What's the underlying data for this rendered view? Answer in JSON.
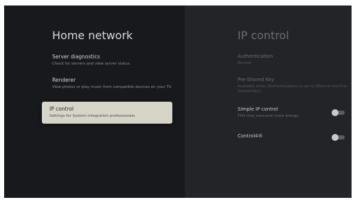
{
  "left_panel": {
    "title": "Home network",
    "items": [
      {
        "label": "Server diagnostics",
        "description": "Check for servers and view server status."
      },
      {
        "label": "Renderer",
        "description": "View photos or play music from compatible devices on your TV."
      },
      {
        "label": "IP control",
        "description": "Settings for System integration professionals.",
        "focused": true
      }
    ]
  },
  "right_panel": {
    "title": "IP control",
    "settings": [
      {
        "label": "Authentication",
        "value": "Normal",
        "enabled": false
      },
      {
        "label": "Pre-Shared Key",
        "value": "Available when [Authentication] is set to [Normal and Pre-Shared Key].",
        "enabled": false
      },
      {
        "label": "Simple IP control",
        "value": "This may consume more energy.",
        "enabled": true,
        "toggle_on": false
      },
      {
        "label": "Control4®",
        "enabled": true,
        "toggle_on": false
      }
    ]
  },
  "colors": {
    "screen_bg": "#232427",
    "left_bg": "#18191c",
    "focus_bg": "#d7d5c8",
    "text_primary": "#d9dadc",
    "text_disabled": "#6b6d71"
  }
}
